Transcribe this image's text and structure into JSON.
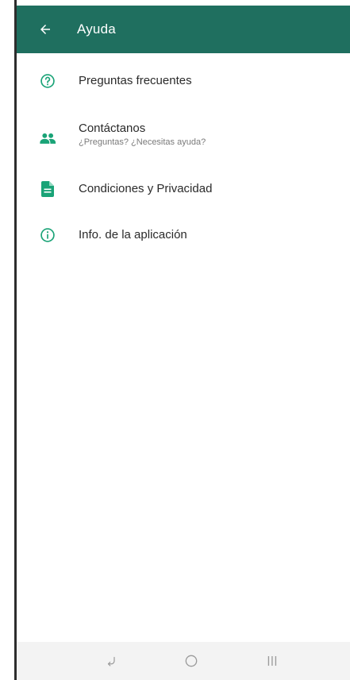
{
  "appbar": {
    "title": "Ayuda",
    "back_icon": "arrow-left-icon",
    "background_color": "#1f6f5f"
  },
  "menu": {
    "items": [
      {
        "label": "Preguntas frecuentes",
        "subtitle": "",
        "icon": "help-circle-icon"
      },
      {
        "label": "Contáctanos",
        "subtitle": "¿Preguntas? ¿Necesitas ayuda?",
        "icon": "contacts-icon"
      },
      {
        "label": "Condiciones y Privacidad",
        "subtitle": "",
        "icon": "document-icon"
      },
      {
        "label": "Info. de la aplicación",
        "subtitle": "",
        "icon": "info-circle-icon"
      }
    ],
    "icon_color": "#1aa377"
  },
  "navbar": {
    "buttons": [
      "back-gesture-icon",
      "home-circle-icon",
      "recent-apps-icon"
    ]
  }
}
